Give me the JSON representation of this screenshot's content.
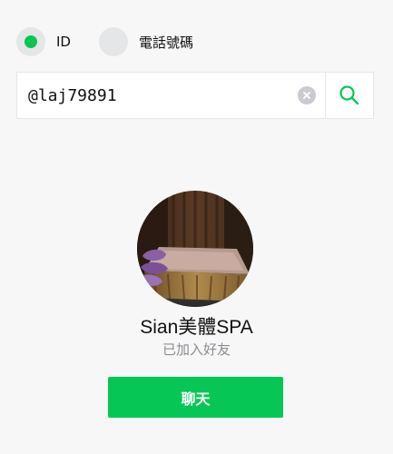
{
  "search_type": {
    "options": [
      {
        "label": "ID",
        "selected": true
      },
      {
        "label": "電話號碼",
        "selected": false
      }
    ]
  },
  "search": {
    "value": "@laj79891",
    "clear_icon": "clear-icon",
    "search_icon": "search-icon"
  },
  "result": {
    "name": "Sian美體SPA",
    "status": "已加入好友",
    "chat_label": "聊天",
    "avatar": "avatar-photo"
  },
  "colors": {
    "accent": "#06c755",
    "status_text": "#8a8d92",
    "background": "#f7f7f7"
  }
}
